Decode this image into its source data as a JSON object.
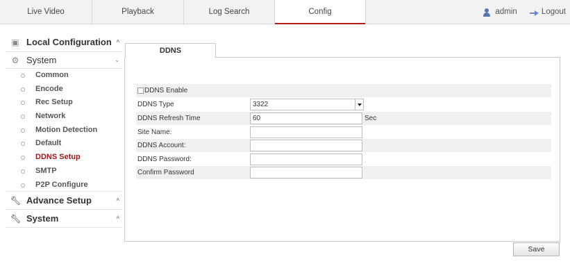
{
  "nav": {
    "tabs": [
      {
        "label": "Live Video"
      },
      {
        "label": "Playback"
      },
      {
        "label": "Log Search"
      },
      {
        "label": "Config"
      }
    ],
    "active_tab": "Config",
    "user": "admin",
    "logout_label": "Logout",
    "accent_color": "#b71c1c"
  },
  "sidebar": {
    "local_config": {
      "label": "Local Configuration",
      "icon": "monitor-icon"
    },
    "system": {
      "label": "System",
      "icon": "gear-icon"
    },
    "items": [
      {
        "label": "Common"
      },
      {
        "label": "Encode"
      },
      {
        "label": "Rec Setup"
      },
      {
        "label": "Network"
      },
      {
        "label": "Motion Detection"
      },
      {
        "label": "Default"
      },
      {
        "label": "DDNS Setup"
      },
      {
        "label": "SMTP"
      },
      {
        "label": "P2P Configure"
      }
    ],
    "active_item": "DDNS Setup",
    "advance_setup": {
      "label": "Advance Setup",
      "icon": "wrench-icon"
    },
    "system2": {
      "label": "System",
      "icon": "wrench-icon"
    }
  },
  "panel": {
    "tab_label": "DDNS",
    "ddns_enable": {
      "label": "DDNS Enable",
      "checked": false
    },
    "ddns_type": {
      "label": "DDNS Type",
      "value": "3322"
    },
    "refresh_time": {
      "label": "DDNS Refresh Time",
      "value": "60",
      "unit": "Sec"
    },
    "site_name": {
      "label": "Site Name:",
      "value": ""
    },
    "account": {
      "label": "DDNS Account:",
      "value": ""
    },
    "password": {
      "label": "DDNS Password:",
      "value": ""
    },
    "confirm_password": {
      "label": "Confirm Password",
      "value": ""
    },
    "save_label": "Save"
  }
}
